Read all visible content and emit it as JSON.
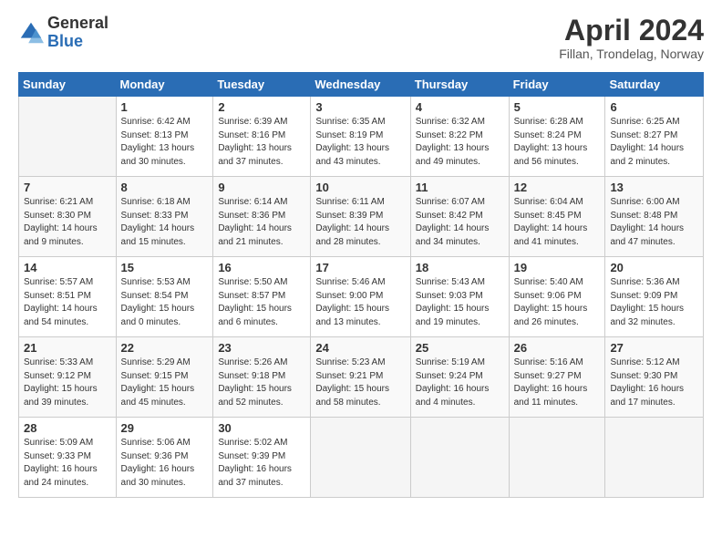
{
  "logo": {
    "general": "General",
    "blue": "Blue"
  },
  "header": {
    "title": "April 2024",
    "location": "Fillan, Trondelag, Norway"
  },
  "weekdays": [
    "Sunday",
    "Monday",
    "Tuesday",
    "Wednesday",
    "Thursday",
    "Friday",
    "Saturday"
  ],
  "weeks": [
    [
      {
        "day": "",
        "info": ""
      },
      {
        "day": "1",
        "info": "Sunrise: 6:42 AM\nSunset: 8:13 PM\nDaylight: 13 hours\nand 30 minutes."
      },
      {
        "day": "2",
        "info": "Sunrise: 6:39 AM\nSunset: 8:16 PM\nDaylight: 13 hours\nand 37 minutes."
      },
      {
        "day": "3",
        "info": "Sunrise: 6:35 AM\nSunset: 8:19 PM\nDaylight: 13 hours\nand 43 minutes."
      },
      {
        "day": "4",
        "info": "Sunrise: 6:32 AM\nSunset: 8:22 PM\nDaylight: 13 hours\nand 49 minutes."
      },
      {
        "day": "5",
        "info": "Sunrise: 6:28 AM\nSunset: 8:24 PM\nDaylight: 13 hours\nand 56 minutes."
      },
      {
        "day": "6",
        "info": "Sunrise: 6:25 AM\nSunset: 8:27 PM\nDaylight: 14 hours\nand 2 minutes."
      }
    ],
    [
      {
        "day": "7",
        "info": "Sunrise: 6:21 AM\nSunset: 8:30 PM\nDaylight: 14 hours\nand 9 minutes."
      },
      {
        "day": "8",
        "info": "Sunrise: 6:18 AM\nSunset: 8:33 PM\nDaylight: 14 hours\nand 15 minutes."
      },
      {
        "day": "9",
        "info": "Sunrise: 6:14 AM\nSunset: 8:36 PM\nDaylight: 14 hours\nand 21 minutes."
      },
      {
        "day": "10",
        "info": "Sunrise: 6:11 AM\nSunset: 8:39 PM\nDaylight: 14 hours\nand 28 minutes."
      },
      {
        "day": "11",
        "info": "Sunrise: 6:07 AM\nSunset: 8:42 PM\nDaylight: 14 hours\nand 34 minutes."
      },
      {
        "day": "12",
        "info": "Sunrise: 6:04 AM\nSunset: 8:45 PM\nDaylight: 14 hours\nand 41 minutes."
      },
      {
        "day": "13",
        "info": "Sunrise: 6:00 AM\nSunset: 8:48 PM\nDaylight: 14 hours\nand 47 minutes."
      }
    ],
    [
      {
        "day": "14",
        "info": "Sunrise: 5:57 AM\nSunset: 8:51 PM\nDaylight: 14 hours\nand 54 minutes."
      },
      {
        "day": "15",
        "info": "Sunrise: 5:53 AM\nSunset: 8:54 PM\nDaylight: 15 hours\nand 0 minutes."
      },
      {
        "day": "16",
        "info": "Sunrise: 5:50 AM\nSunset: 8:57 PM\nDaylight: 15 hours\nand 6 minutes."
      },
      {
        "day": "17",
        "info": "Sunrise: 5:46 AM\nSunset: 9:00 PM\nDaylight: 15 hours\nand 13 minutes."
      },
      {
        "day": "18",
        "info": "Sunrise: 5:43 AM\nSunset: 9:03 PM\nDaylight: 15 hours\nand 19 minutes."
      },
      {
        "day": "19",
        "info": "Sunrise: 5:40 AM\nSunset: 9:06 PM\nDaylight: 15 hours\nand 26 minutes."
      },
      {
        "day": "20",
        "info": "Sunrise: 5:36 AM\nSunset: 9:09 PM\nDaylight: 15 hours\nand 32 minutes."
      }
    ],
    [
      {
        "day": "21",
        "info": "Sunrise: 5:33 AM\nSunset: 9:12 PM\nDaylight: 15 hours\nand 39 minutes."
      },
      {
        "day": "22",
        "info": "Sunrise: 5:29 AM\nSunset: 9:15 PM\nDaylight: 15 hours\nand 45 minutes."
      },
      {
        "day": "23",
        "info": "Sunrise: 5:26 AM\nSunset: 9:18 PM\nDaylight: 15 hours\nand 52 minutes."
      },
      {
        "day": "24",
        "info": "Sunrise: 5:23 AM\nSunset: 9:21 PM\nDaylight: 15 hours\nand 58 minutes."
      },
      {
        "day": "25",
        "info": "Sunrise: 5:19 AM\nSunset: 9:24 PM\nDaylight: 16 hours\nand 4 minutes."
      },
      {
        "day": "26",
        "info": "Sunrise: 5:16 AM\nSunset: 9:27 PM\nDaylight: 16 hours\nand 11 minutes."
      },
      {
        "day": "27",
        "info": "Sunrise: 5:12 AM\nSunset: 9:30 PM\nDaylight: 16 hours\nand 17 minutes."
      }
    ],
    [
      {
        "day": "28",
        "info": "Sunrise: 5:09 AM\nSunset: 9:33 PM\nDaylight: 16 hours\nand 24 minutes."
      },
      {
        "day": "29",
        "info": "Sunrise: 5:06 AM\nSunset: 9:36 PM\nDaylight: 16 hours\nand 30 minutes."
      },
      {
        "day": "30",
        "info": "Sunrise: 5:02 AM\nSunset: 9:39 PM\nDaylight: 16 hours\nand 37 minutes."
      },
      {
        "day": "",
        "info": ""
      },
      {
        "day": "",
        "info": ""
      },
      {
        "day": "",
        "info": ""
      },
      {
        "day": "",
        "info": ""
      }
    ]
  ]
}
